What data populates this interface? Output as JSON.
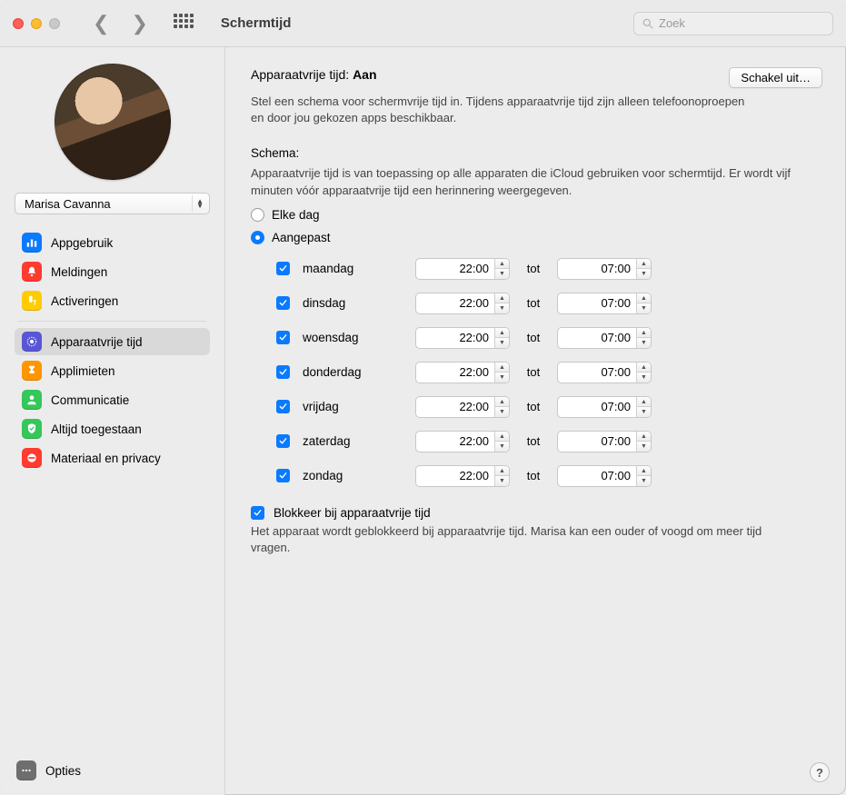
{
  "window": {
    "title": "Schermtijd"
  },
  "search": {
    "placeholder": "Zoek"
  },
  "user": {
    "name": "Marisa Cavanna"
  },
  "sidebar": {
    "group1": [
      {
        "label": "Appgebruik"
      },
      {
        "label": "Meldingen"
      },
      {
        "label": "Activeringen"
      }
    ],
    "group2": [
      {
        "label": "Apparaatvrije tijd"
      },
      {
        "label": "Applimieten"
      },
      {
        "label": "Communicatie"
      },
      {
        "label": "Altijd toegestaan"
      },
      {
        "label": "Materiaal en privacy"
      }
    ],
    "options_label": "Opties"
  },
  "main": {
    "title_prefix": "Apparaatvrije tijd: ",
    "title_state": "Aan",
    "disable_btn": "Schakel uit…",
    "intro": "Stel een schema voor schermvrije tijd in. Tijdens apparaatvrije tijd zijn alleen telefoonoproepen en door jou gekozen apps beschikbaar.",
    "schema_title": "Schema:",
    "schema_desc": "Apparaatvrije tijd is van toepassing op alle apparaten die iCloud gebruiken voor schermtijd. Er wordt vijf minuten vóór apparaatvrije tijd een herinnering weergegeven.",
    "radio_everyday": "Elke dag",
    "radio_custom": "Aangepast",
    "tot": "tot",
    "days": [
      {
        "name": "maandag",
        "on": true,
        "from": "22:00",
        "to": "07:00"
      },
      {
        "name": "dinsdag",
        "on": true,
        "from": "22:00",
        "to": "07:00"
      },
      {
        "name": "woensdag",
        "on": true,
        "from": "22:00",
        "to": "07:00"
      },
      {
        "name": "donderdag",
        "on": true,
        "from": "22:00",
        "to": "07:00"
      },
      {
        "name": "vrijdag",
        "on": true,
        "from": "22:00",
        "to": "07:00"
      },
      {
        "name": "zaterdag",
        "on": true,
        "from": "22:00",
        "to": "07:00"
      },
      {
        "name": "zondag",
        "on": true,
        "from": "22:00",
        "to": "07:00"
      }
    ],
    "block_label": "Blokkeer bij apparaatvrije tijd",
    "block_desc": "Het apparaat wordt geblokkeerd bij apparaatvrije tijd. Marisa kan een ouder of voogd om meer tijd vragen."
  }
}
